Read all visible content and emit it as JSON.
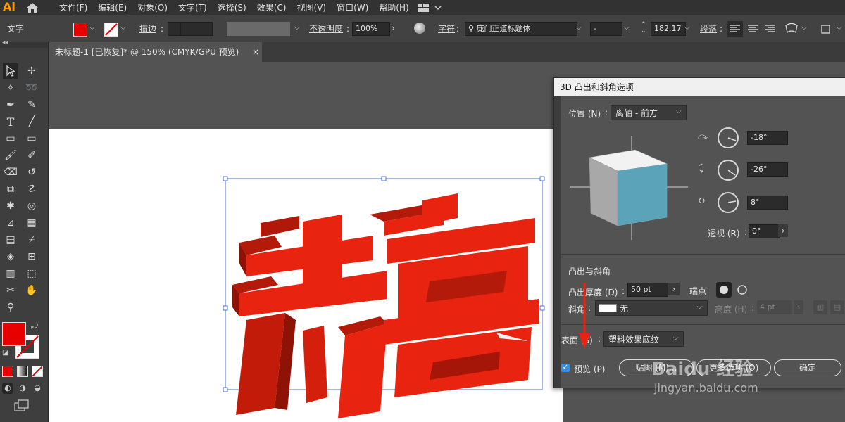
{
  "menubar": {
    "logo": "Ai",
    "items": [
      "文件(F)",
      "编辑(E)",
      "对象(O)",
      "文字(T)",
      "选择(S)",
      "效果(C)",
      "视图(V)",
      "窗口(W)",
      "帮助(H)"
    ]
  },
  "controlbar": {
    "type_label": "文字",
    "stroke_label": "描边",
    "opacity_label": "不透明度",
    "opacity_value": "100%",
    "char_label": "字符",
    "font_name": "庞门正道标题体",
    "font_style": "-",
    "font_size": "182.17",
    "para_label": "段落",
    "fill_color": "#e60000"
  },
  "tab": {
    "title": "未标题-1 [已恢复]* @ 150% (CMYK/GPU 预览)",
    "close": "×"
  },
  "artwork": {
    "text": "恭喜",
    "front_color": "#e8230f",
    "side_color": "#a51608"
  },
  "dialog": {
    "title": "3D 凸出和斜角选项",
    "position_label": "位置 (N)",
    "position_value": "离轴 - 前方",
    "rot_x": "-18°",
    "rot_y": "-26°",
    "rot_z": "8°",
    "perspective_label": "透视 (R)",
    "perspective_value": "0°",
    "extrude_section": "凸出与斜角",
    "depth_label": "凸出厚度 (D)",
    "depth_value": "50 pt",
    "cap_label": "端点",
    "bevel_label": "斜角",
    "bevel_value": "无",
    "height_label": "高度 (H)",
    "height_value": "4 pt",
    "surface_label": "表面 (S)",
    "surface_value": "塑料效果底纹",
    "preview_label": "预览 (P)",
    "map_button": "贴图 (M)...",
    "more_button": "更多选项 (O)",
    "ok_button": "确定",
    "cube_face_color": "#5aa3b8"
  },
  "watermark": {
    "brand": "Baidu 经验",
    "url": "jingyan.baidu.com"
  }
}
